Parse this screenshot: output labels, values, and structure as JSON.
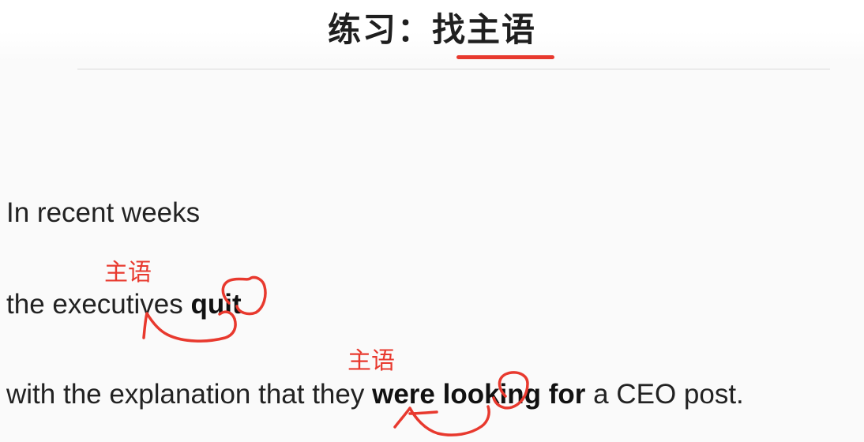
{
  "title": "练习：找主语",
  "lines": [
    {
      "segments": [
        {
          "text": "In recent weeks",
          "bold": false
        }
      ]
    },
    {
      "segments": [
        {
          "text": "the executives ",
          "bold": false
        },
        {
          "text": "quit",
          "bold": true
        }
      ]
    },
    {
      "segments": [
        {
          "text": "with the explanation that they ",
          "bold": false
        },
        {
          "text": "were looking for",
          "bold": true
        },
        {
          "text": " a CEO post.",
          "bold": false
        }
      ]
    }
  ],
  "annotations": [
    {
      "text": "主语"
    },
    {
      "text": "主语"
    }
  ],
  "colors": {
    "accent": "#e8392e",
    "text": "#222222",
    "divider": "#d9d9d9"
  }
}
